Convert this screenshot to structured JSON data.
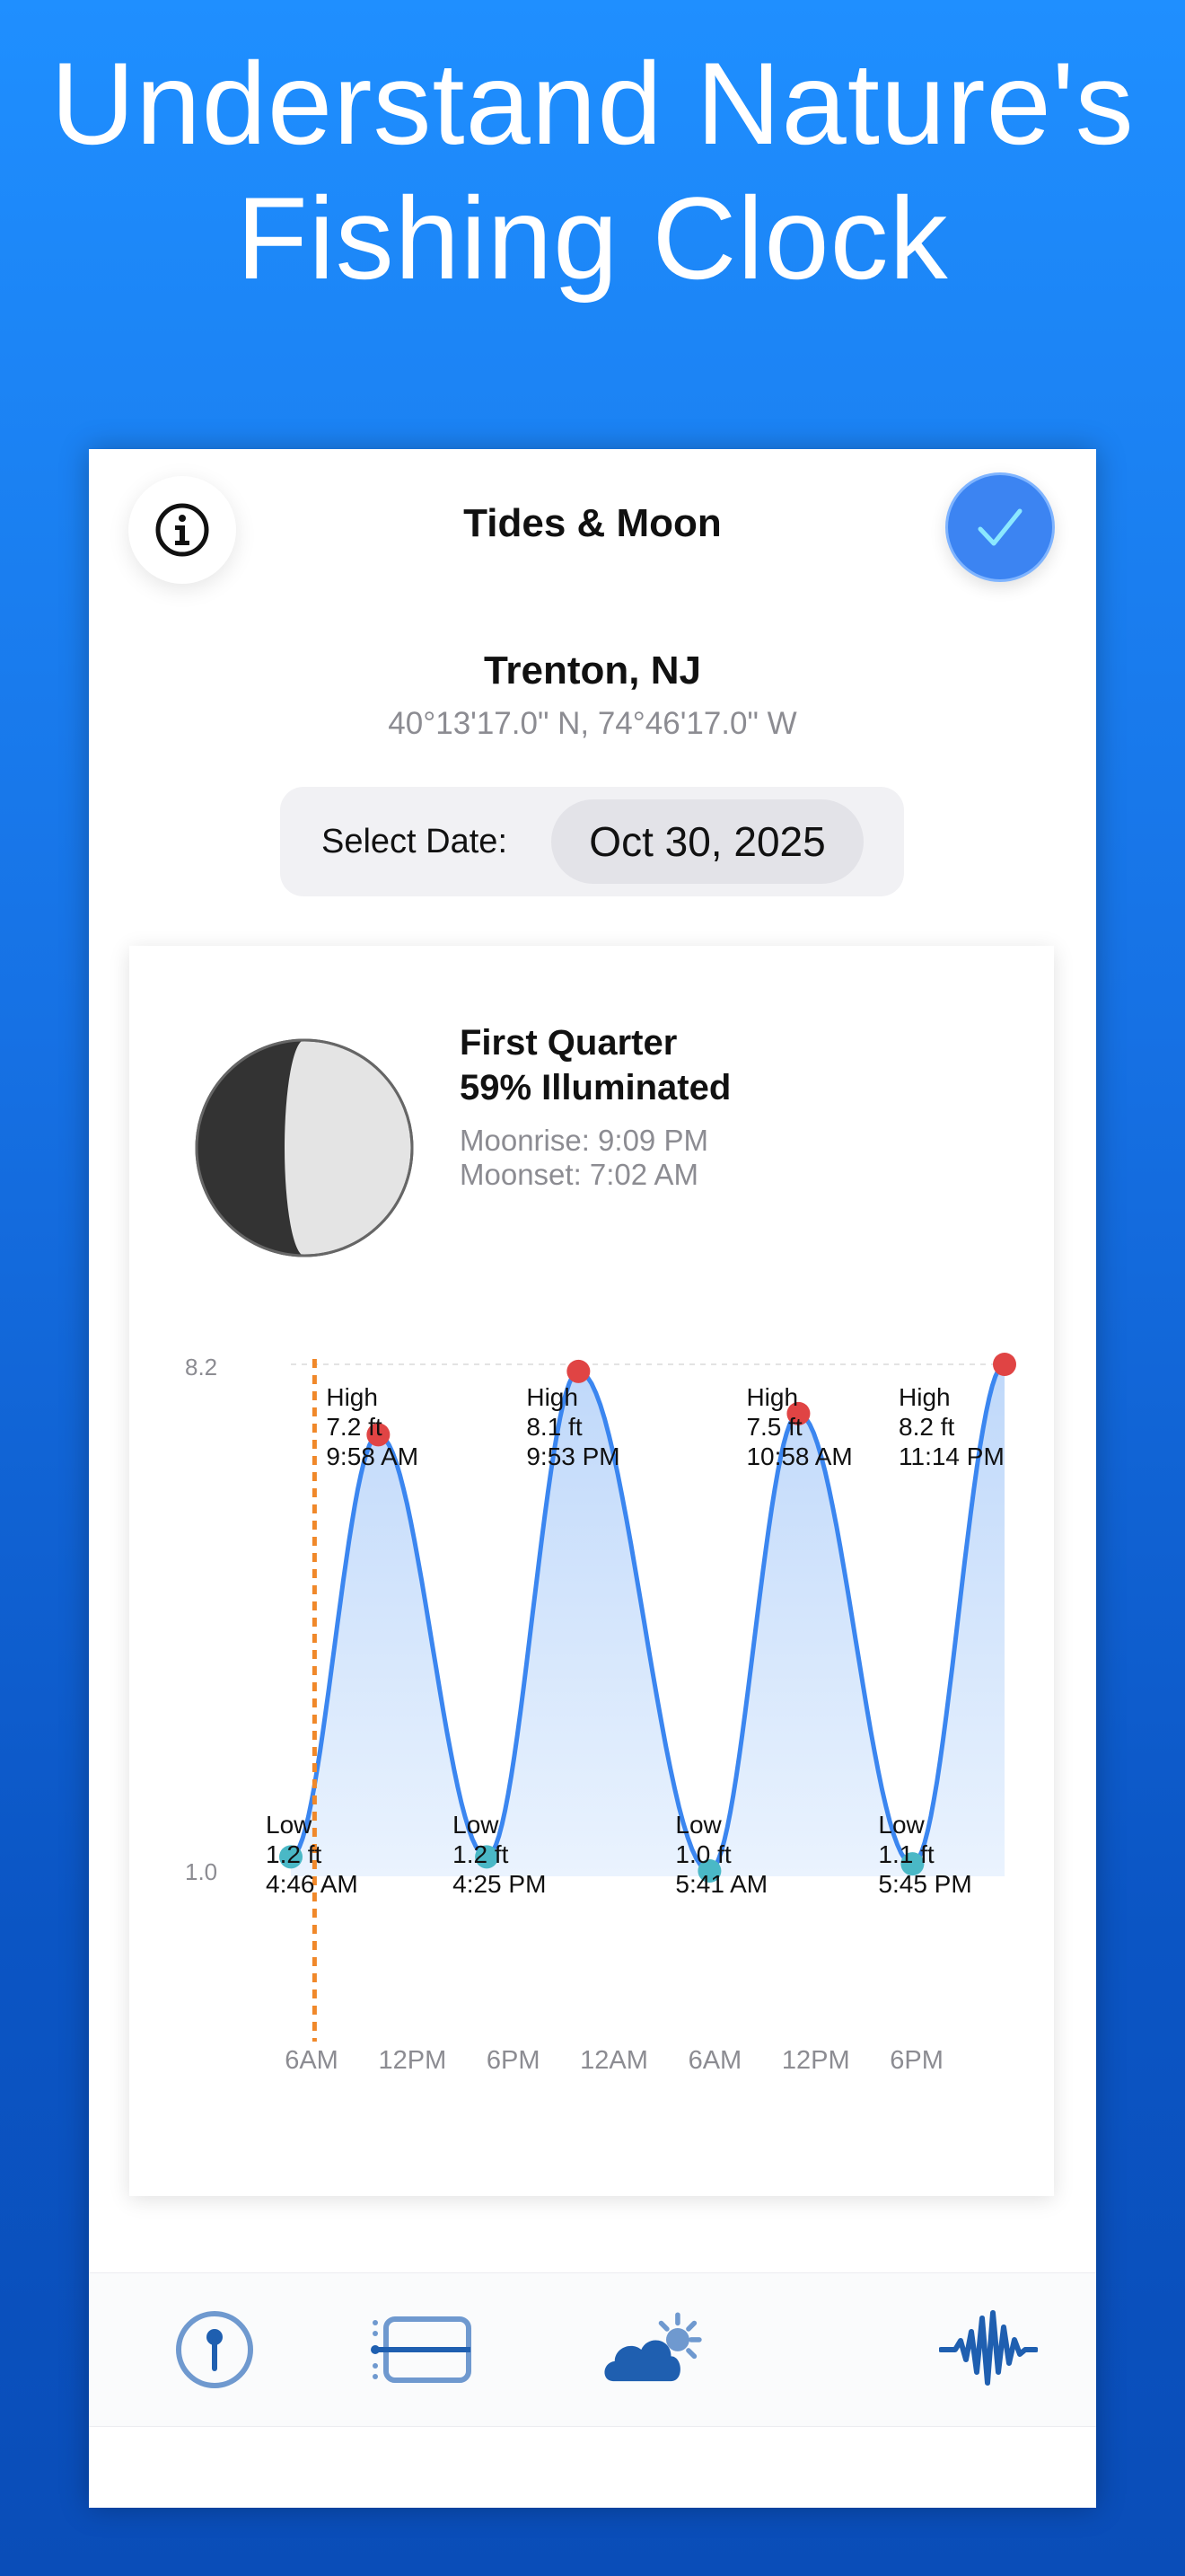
{
  "headline": {
    "line1": "Understand Nature's",
    "line2": "Fishing Clock"
  },
  "nav": {
    "title": "Tides & Moon",
    "info_icon": "info-icon",
    "confirm_icon": "checkmark-icon"
  },
  "location": {
    "name": "Trenton, NJ",
    "coords": "40°13'17.0\" N, 74°46'17.0\" W"
  },
  "date": {
    "label": "Select Date:",
    "value": "Oct 30, 2025"
  },
  "moon": {
    "phase": "First Quarter",
    "illumination": "59% Illuminated",
    "illumination_fraction": 0.59,
    "moonrise": "Moonrise: 9:09 PM",
    "moonset": "Moonset: 7:02 AM"
  },
  "chart_data": {
    "type": "line",
    "x_tick_labels": [
      "6AM",
      "12PM",
      "6PM",
      "12AM",
      "6AM",
      "12PM",
      "6PM"
    ],
    "ylim": [
      1.0,
      8.2
    ],
    "y_tick_labels": [
      "8.2",
      "1.0"
    ],
    "current_time_marker": "6:11 AM",
    "colors": {
      "line": "#3b86f0",
      "fill": "#cfe2fb",
      "high": "#e04444",
      "low": "#4ab8c6",
      "now": "#f0882a"
    },
    "extremes": [
      {
        "kind": "Low",
        "height": 1.2,
        "height_label": "1.2 ft",
        "time": "4:46 AM",
        "hours": 4.77
      },
      {
        "kind": "High",
        "height": 7.2,
        "height_label": "7.2 ft",
        "time": "9:58 AM",
        "hours": 9.97
      },
      {
        "kind": "Low",
        "height": 1.2,
        "height_label": "1.2 ft",
        "time": "4:25 PM",
        "hours": 16.42
      },
      {
        "kind": "High",
        "height": 8.1,
        "height_label": "8.1 ft",
        "time": "9:53 PM",
        "hours": 21.88
      },
      {
        "kind": "Low",
        "height": 1.0,
        "height_label": "1.0 ft",
        "time": "5:41 AM",
        "hours": 29.68
      },
      {
        "kind": "High",
        "height": 7.5,
        "height_label": "7.5 ft",
        "time": "10:58 AM",
        "hours": 34.97
      },
      {
        "kind": "Low",
        "height": 1.1,
        "height_label": "1.1 ft",
        "time": "5:45 PM",
        "hours": 41.75
      },
      {
        "kind": "High",
        "height": 8.2,
        "height_label": "8.2 ft",
        "time": "11:14 PM",
        "hours": 47.23
      }
    ]
  },
  "tabs": [
    {
      "icon": "compass-pin-icon"
    },
    {
      "icon": "timeline-icon"
    },
    {
      "icon": "weather-icon"
    },
    {
      "icon": "waveform-icon"
    }
  ]
}
